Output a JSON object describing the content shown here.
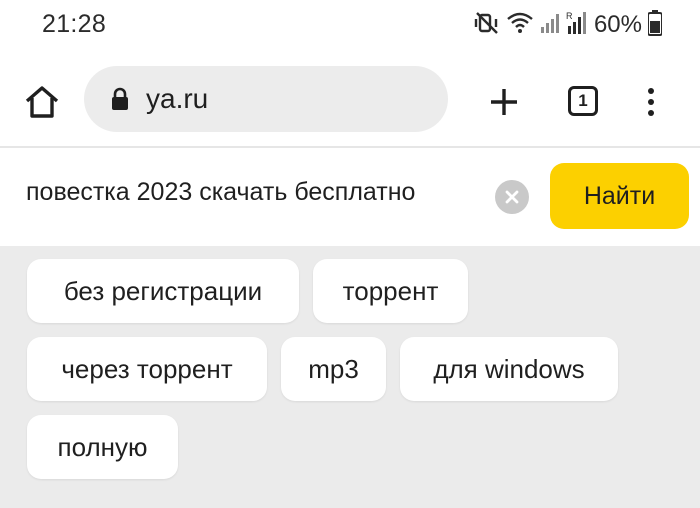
{
  "status_bar": {
    "time": "21:28",
    "battery": "60%",
    "icons": [
      "mute-vibrate-icon",
      "wifi-icon",
      "signal-icon",
      "roaming-signal-icon",
      "battery-icon"
    ]
  },
  "toolbar": {
    "url": "ya.ru",
    "tab_count": "1",
    "icons": [
      "home-icon",
      "lock-icon",
      "plus-icon",
      "tabs-icon",
      "more-menu-icon"
    ]
  },
  "search": {
    "query": "повестка 2023 скачать бесплатно",
    "find_label": "Найти"
  },
  "suggestions": [
    "без регистрации",
    "торрент",
    "через торрент",
    "mp3",
    "для windows",
    "полную"
  ],
  "colors": {
    "find_button": "#fcd000",
    "suggest_bg": "#ebebeb",
    "url_bar_bg": "#ececec"
  }
}
